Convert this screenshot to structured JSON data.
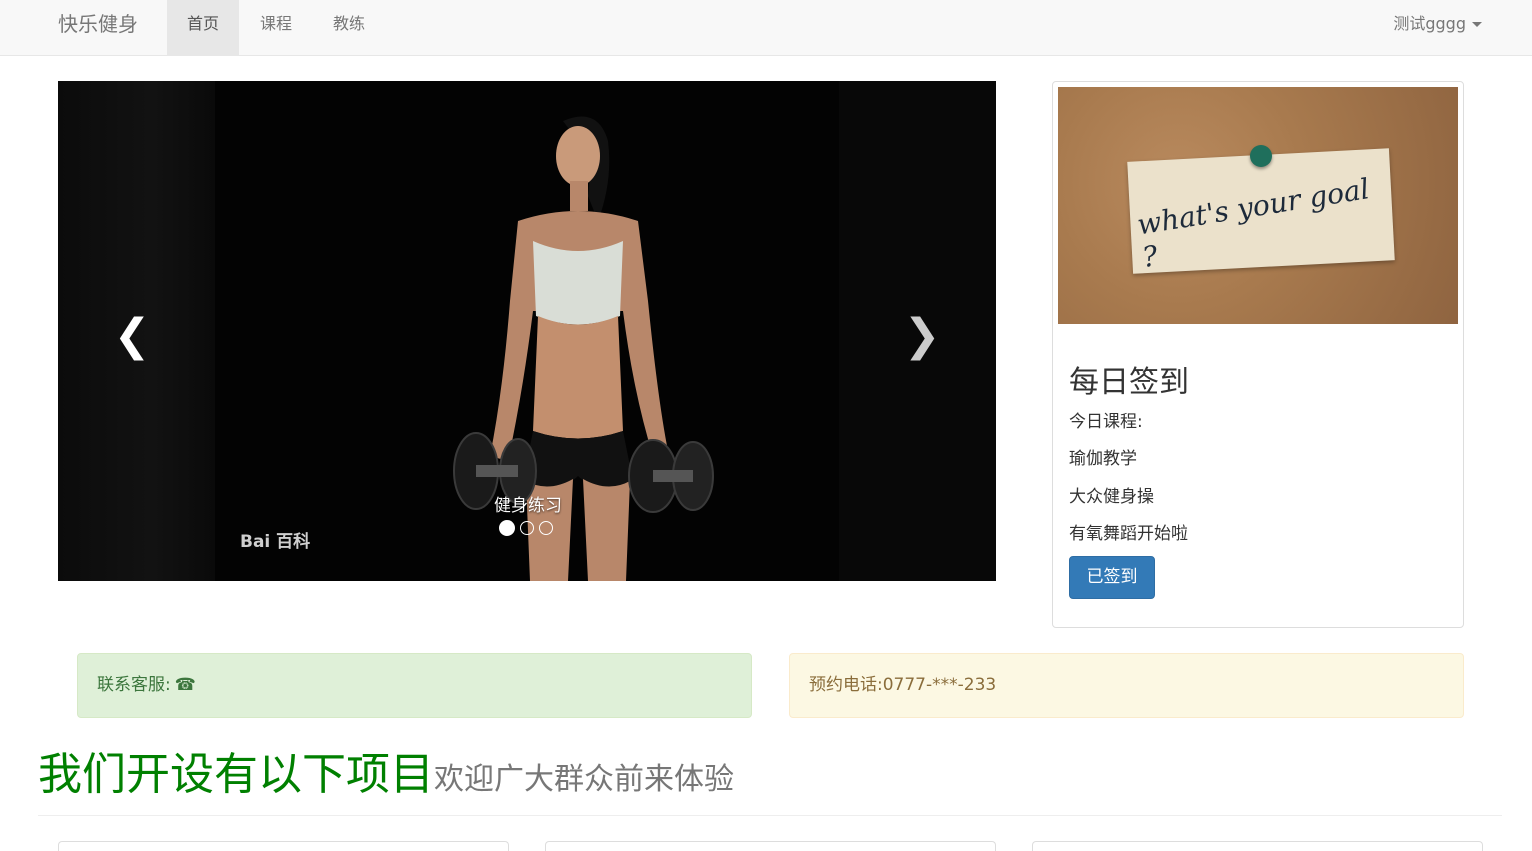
{
  "navbar": {
    "brand": "快乐健身",
    "items": [
      {
        "label": "首页",
        "active": true
      },
      {
        "label": "课程",
        "active": false
      },
      {
        "label": "教练",
        "active": false
      }
    ],
    "user": "测试gggg"
  },
  "carousel": {
    "caption": "健身练习",
    "watermark": "Bai 百科",
    "prev_icon": "chevron-left-icon",
    "next_icon": "chevron-right-icon",
    "slide_count": 3,
    "active_slide": 1
  },
  "checkin": {
    "image_text": "what's your goal ?",
    "title": "每日签到",
    "today_label": "今日课程:",
    "courses": [
      "瑜伽教学",
      "大众健身操",
      "有氧舞蹈开始啦"
    ],
    "button_label": "已签到"
  },
  "alerts": {
    "service_label": "联系客服:",
    "service_icon": "☎",
    "phone_label": "预约电话:0777-***-233"
  },
  "section": {
    "title": "我们开设有以下项目",
    "subtitle": "欢迎广大群众前来体验"
  },
  "colors": {
    "primary": "#337ab7",
    "success_bg": "#dff0d8",
    "warning_bg": "#fcf8e3",
    "heading_green": "#008000"
  }
}
